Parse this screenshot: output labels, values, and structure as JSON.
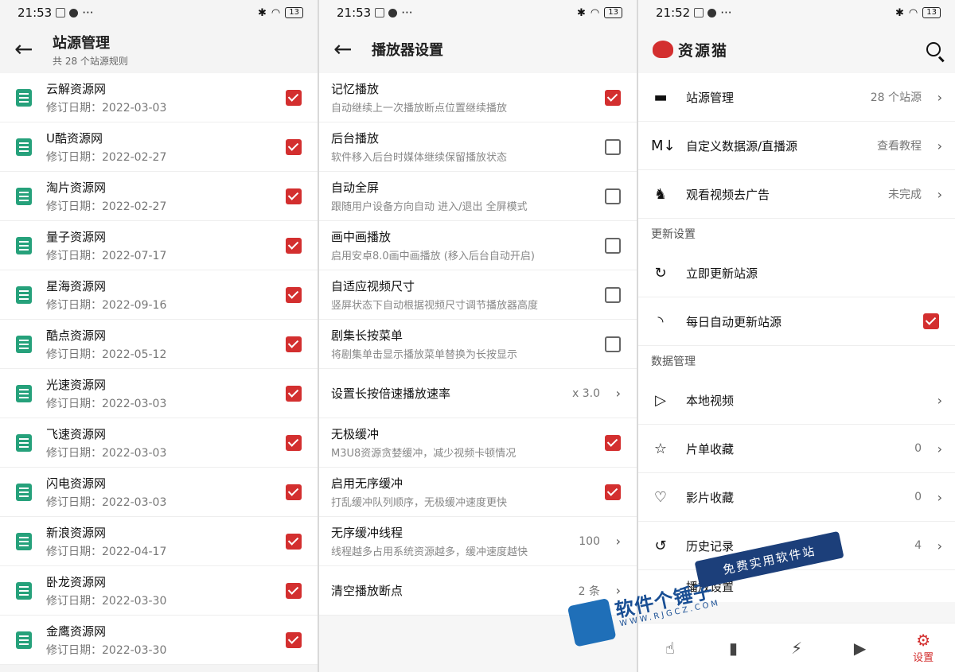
{
  "status_bars": [
    {
      "time": "21:53",
      "battery": "13"
    },
    {
      "time": "21:53",
      "battery": "13"
    },
    {
      "time": "21:52",
      "battery": "13"
    }
  ],
  "panel1": {
    "title": "站源管理",
    "subtitle": "共 28 个站源规则",
    "items": [
      {
        "name": "云解资源网",
        "date": "修订日期：2022-03-03"
      },
      {
        "name": "U酷资源网",
        "date": "修订日期：2022-02-27"
      },
      {
        "name": "淘片资源网",
        "date": "修订日期：2022-02-27"
      },
      {
        "name": "量子资源网",
        "date": "修订日期：2022-07-17"
      },
      {
        "name": "星海资源网",
        "date": "修订日期：2022-09-16"
      },
      {
        "name": "酷点资源网",
        "date": "修订日期：2022-05-12"
      },
      {
        "name": "光速资源网",
        "date": "修订日期：2022-03-03"
      },
      {
        "name": "飞速资源网",
        "date": "修订日期：2022-03-03"
      },
      {
        "name": "闪电资源网",
        "date": "修订日期：2022-03-03"
      },
      {
        "name": "新浪资源网",
        "date": "修订日期：2022-04-17"
      },
      {
        "name": "卧龙资源网",
        "date": "修订日期：2022-03-30"
      },
      {
        "name": "金鹰资源网",
        "date": "修订日期：2022-03-30"
      }
    ]
  },
  "panel2": {
    "title": "播放器设置",
    "items": [
      {
        "title": "记忆播放",
        "desc": "自动继续上一次播放断点位置继续播放",
        "checked": true
      },
      {
        "title": "后台播放",
        "desc": "软件移入后台时媒体继续保留播放状态",
        "checked": false
      },
      {
        "title": "自动全屏",
        "desc": "跟随用户设备方向自动 进入/退出 全屏模式",
        "checked": false
      },
      {
        "title": "画中画播放",
        "desc": "启用安卓8.0画中画播放 (移入后台自动开启)",
        "checked": false
      },
      {
        "title": "自适应视频尺寸",
        "desc": "竖屏状态下自动根据视频尺寸调节播放器高度",
        "checked": false
      },
      {
        "title": "剧集长按菜单",
        "desc": "将剧集单击显示播放菜单替换为长按显示",
        "checked": false
      }
    ],
    "speed": {
      "title": "设置长按倍速播放速率",
      "value": "x 3.0"
    },
    "items2": [
      {
        "title": "无极缓冲",
        "desc": "M3U8资源贪婪缓冲，减少视频卡顿情况",
        "checked": true
      },
      {
        "title": "启用无序缓冲",
        "desc": "打乱缓冲队列顺序，无极缓冲速度更快",
        "checked": true
      }
    ],
    "threads": {
      "title": "无序缓冲线程",
      "desc": "线程越多占用系统资源越多，缓冲速度越快",
      "value": "100"
    },
    "clear": {
      "title": "清空播放断点",
      "value": "2 条"
    }
  },
  "panel3": {
    "brand": "资源猫",
    "top_items": [
      {
        "icon": "folder-icon",
        "glyph": "▬",
        "title": "站源管理",
        "value": "28 个站源"
      },
      {
        "icon": "markdown-icon",
        "glyph": "M↓",
        "title": "自定义数据源/直播源",
        "value": "查看教程"
      },
      {
        "icon": "rocking-horse-icon",
        "glyph": "♞",
        "title": "观看视频去广告",
        "value": "未完成"
      }
    ],
    "section_update": "更新设置",
    "update_items": [
      {
        "icon": "refresh-icon",
        "glyph": "↻",
        "title": "立即更新站源"
      },
      {
        "icon": "rss-icon",
        "glyph": "◝",
        "title": "每日自动更新站源"
      }
    ],
    "section_data": "数据管理",
    "data_items": [
      {
        "icon": "local-video-icon",
        "glyph": "▷",
        "title": "本地视频",
        "value": ""
      },
      {
        "icon": "star-icon",
        "glyph": "☆",
        "title": "片单收藏",
        "value": "0"
      },
      {
        "icon": "heart-icon",
        "glyph": "♡",
        "title": "影片收藏",
        "value": "0"
      },
      {
        "icon": "history-icon",
        "glyph": "↺",
        "title": "历史记录",
        "value": "4"
      }
    ],
    "partial_item": "播放设置",
    "nav": [
      {
        "icon": "hand-sparkle-icon",
        "glyph": "☝",
        "label": ""
      },
      {
        "icon": "bar-chart-icon",
        "glyph": "▮",
        "label": ""
      },
      {
        "icon": "lightning-icon",
        "glyph": "⚡",
        "label": ""
      },
      {
        "icon": "play-box-icon",
        "glyph": "▶",
        "label": ""
      },
      {
        "icon": "gear-icon",
        "glyph": "⚙",
        "label": "设置"
      }
    ]
  },
  "watermark": {
    "main": "软件个锤子",
    "sub": "WWW.RJGCZ.COM",
    "tag": "免费实用软件站"
  },
  "colors": {
    "accent": "#d32f2f",
    "doc_icon": "#26a17b",
    "watermark": "#1c3f7a"
  }
}
